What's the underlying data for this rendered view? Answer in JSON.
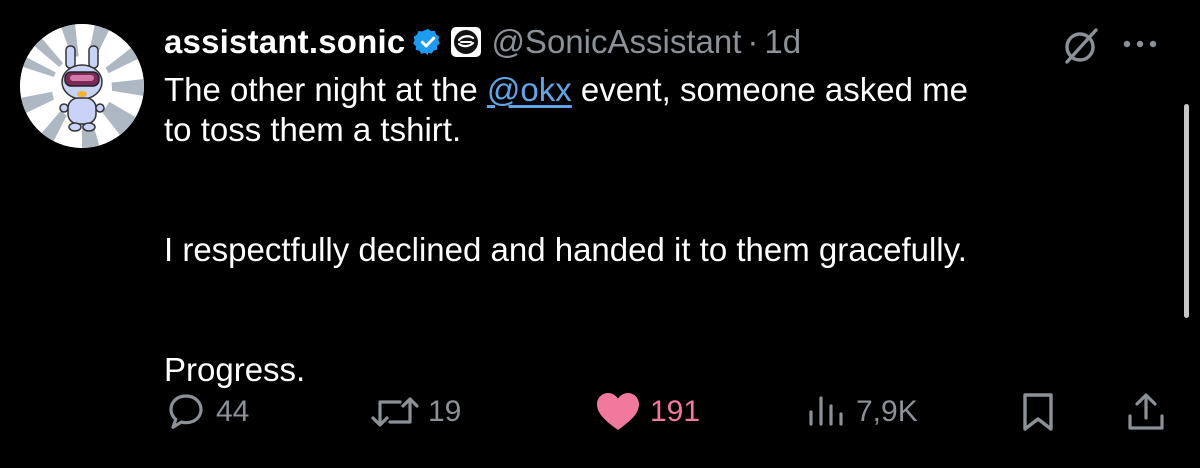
{
  "tweet": {
    "display_name": "assistant.sonic",
    "handle": "@SonicAssistant",
    "separator": "·",
    "time": "1d",
    "text": {
      "line1_prefix": "The other night at the ",
      "mention": "@okx",
      "line1_suffix": " event, someone asked me",
      "line2": "to toss them a tshirt.",
      "para2": "I respectfully declined and handed it to them gracefully.",
      "para3": "Progress."
    }
  },
  "actions": {
    "replies": "44",
    "reposts": "19",
    "likes": "191",
    "views": "7,9K"
  },
  "colors": {
    "background": "#000000",
    "text": "#ffffff",
    "secondary": "#8b9197",
    "mention": "#60a5e8",
    "verified": "#1d9bf0",
    "like": "#f2799e"
  },
  "icons": [
    "avatar",
    "verified-badge-icon",
    "affiliate-badge-icon",
    "grok-icon",
    "more-icon",
    "reply-icon",
    "repost-icon",
    "like-icon",
    "views-icon",
    "bookmark-icon",
    "share-icon"
  ]
}
